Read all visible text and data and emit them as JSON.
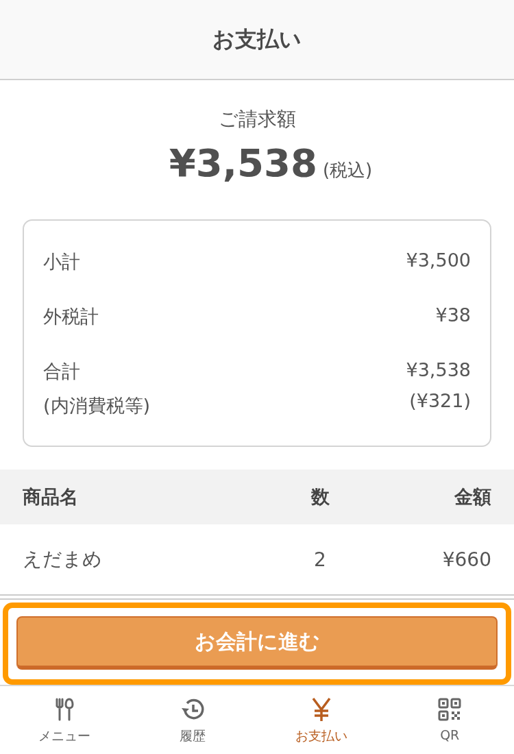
{
  "header": {
    "title": "お支払い"
  },
  "billing": {
    "label": "ご請求額",
    "amount": "¥3,538",
    "tax_note": "(税込)"
  },
  "summary": [
    {
      "label": "小計",
      "value": "¥3,500"
    },
    {
      "label": "外税計",
      "value": "¥38"
    },
    {
      "label": "合計",
      "value": "¥3,538",
      "sub_label": "(内消費税等)",
      "sub_value": "(¥321)"
    }
  ],
  "table": {
    "columns": [
      "商品名",
      "数",
      "金額"
    ],
    "rows": [
      {
        "name": "えだまめ",
        "qty": "2",
        "price": "¥660"
      }
    ]
  },
  "checkout_button": {
    "label": "お会計に進む",
    "focused": true
  },
  "nav": [
    {
      "kind": "menu",
      "label": "メニュー",
      "selected": false
    },
    {
      "kind": "history",
      "label": "履歴",
      "selected": false
    },
    {
      "kind": "payment",
      "label": "お支払い",
      "selected": true
    },
    {
      "kind": "qr",
      "label": "QR",
      "selected": false
    }
  ]
}
